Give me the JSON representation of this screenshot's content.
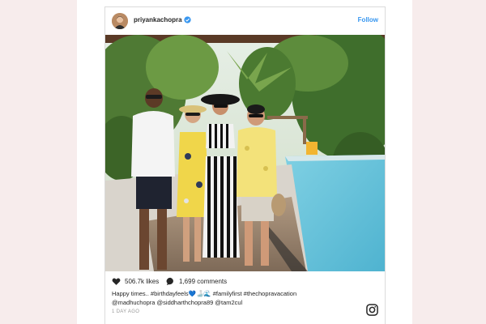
{
  "post": {
    "username": "priyankachopra",
    "follow_label": "Follow",
    "likes": "506.7k likes",
    "comments": "1,699 comments",
    "caption_line1": "Happy times.. #birthdayfeels💙🍶🌊 #familyfirst #thechopravacation",
    "caption_line2": "@madhuchopra @siddharthchopra89 @tam2cul",
    "time": "1 DAY AGO"
  },
  "icons": {
    "verified": "verified-badge-icon",
    "like": "heart-icon",
    "comment": "speech-bubble-icon",
    "brand": "instagram-icon"
  },
  "colors": {
    "follow": "#3897f0",
    "verified": "#3897f0",
    "page_background": "#f7ecec"
  }
}
